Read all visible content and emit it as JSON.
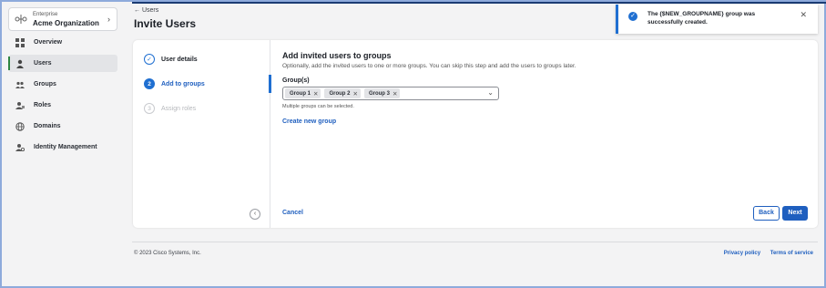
{
  "org": {
    "kicker": "Enterprise",
    "name": "Acme Organization"
  },
  "nav": {
    "items": [
      {
        "label": "Overview",
        "icon": "grid-icon",
        "active": false
      },
      {
        "label": "Users",
        "icon": "user-icon",
        "active": true
      },
      {
        "label": "Groups",
        "icon": "group-icon",
        "active": false
      },
      {
        "label": "Roles",
        "icon": "roles-icon",
        "active": false
      },
      {
        "label": "Domains",
        "icon": "globe-icon",
        "active": false
      },
      {
        "label": "Identity Management",
        "icon": "identity-icon",
        "active": false
      }
    ]
  },
  "header": {
    "breadcrumb": "← Users",
    "title": "Invite Users"
  },
  "toast": {
    "message": "The {$NEW_GROUPNAME} group was successfully created."
  },
  "steps": [
    {
      "number": "✓",
      "label": "User details",
      "state": "done"
    },
    {
      "number": "2",
      "label": "Add to groups",
      "state": "current"
    },
    {
      "number": "3",
      "label": "Assign roles",
      "state": "todo"
    }
  ],
  "main": {
    "title": "Add invited users to groups",
    "description": "Optionally, add the invited users to one or more groups. You can skip this step and add the users to groups later.",
    "field_label": "Group(s)",
    "chips": [
      "Group 1",
      "Group 2",
      "Group 3"
    ],
    "hint": "Multiple groups can be selected.",
    "create_link": "Create new group",
    "cancel": "Cancel",
    "back": "Back",
    "next": "Next"
  },
  "footer": {
    "copyright": "© 2023 Cisco Systems, Inc.",
    "privacy": "Privacy policy",
    "terms": "Terms of service"
  },
  "colors": {
    "accent": "#1f5fbf",
    "active_marker": "#2e8540",
    "toast_border": "#1f6fd1"
  }
}
